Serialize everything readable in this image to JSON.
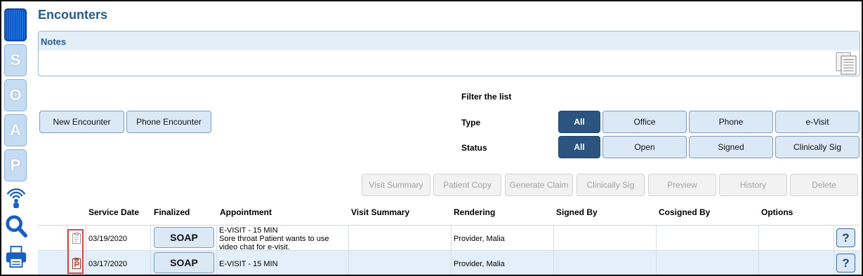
{
  "sidebar": {
    "letters": [
      "S",
      "O",
      "A",
      "P"
    ],
    "icons": [
      "grid-icon",
      "wireless-icon",
      "search-icon",
      "printer-icon"
    ]
  },
  "page": {
    "title": "Encounters"
  },
  "notes": {
    "label": "Notes",
    "icon": "notes-document-icon"
  },
  "actions": {
    "new_encounter": "New Encounter",
    "phone_encounter": "Phone Encounter"
  },
  "filter": {
    "title": "Filter the list",
    "type_label": "Type",
    "status_label": "Status",
    "type_options": [
      "All",
      "Office",
      "Phone",
      "e-Visit"
    ],
    "status_options": [
      "All",
      "Open",
      "Signed",
      "Clinically Sig"
    ],
    "type_selected": "All",
    "status_selected": "All"
  },
  "toolbar": {
    "buttons": [
      "Visit Summary",
      "Patient Copy",
      "Generate Claim",
      "Clinically Sig",
      "Preview",
      "History",
      "Delete"
    ],
    "enabled": false
  },
  "table": {
    "headers": [
      "Service Date",
      "Finalized",
      "Appointment",
      "Visit Summary",
      "Rendering",
      "Signed By",
      "Cosigned By",
      "Options"
    ],
    "rows": [
      {
        "icon": "unsigned-document-icon",
        "service_date": "03/19/2020",
        "finalized": "SOAP",
        "appointment_line1": "E-VISIT - 15 MIN",
        "appointment_line2": "Sore throat Patient wants to use",
        "appointment_line3": "video chat for e-visit.",
        "visit_summary": "",
        "rendering": "Provider, Malia",
        "signed_by": "",
        "cosigned_by": "",
        "options": "?"
      },
      {
        "icon": "preliminary-document-icon",
        "service_date": "03/17/2020",
        "finalized": "SOAP",
        "appointment_line1": "E-VISIT - 15 MIN",
        "appointment_line2": "",
        "appointment_line3": "",
        "visit_summary": "",
        "rendering": "Provider, Malia",
        "signed_by": "",
        "cosigned_by": "",
        "options": "?"
      }
    ]
  },
  "colors": {
    "title": "#2a5a8c",
    "active_filter": "#2b5580",
    "button_bg": "#dbe9f7",
    "row_alt": "#e3effa",
    "highlight": "#e0443e"
  }
}
